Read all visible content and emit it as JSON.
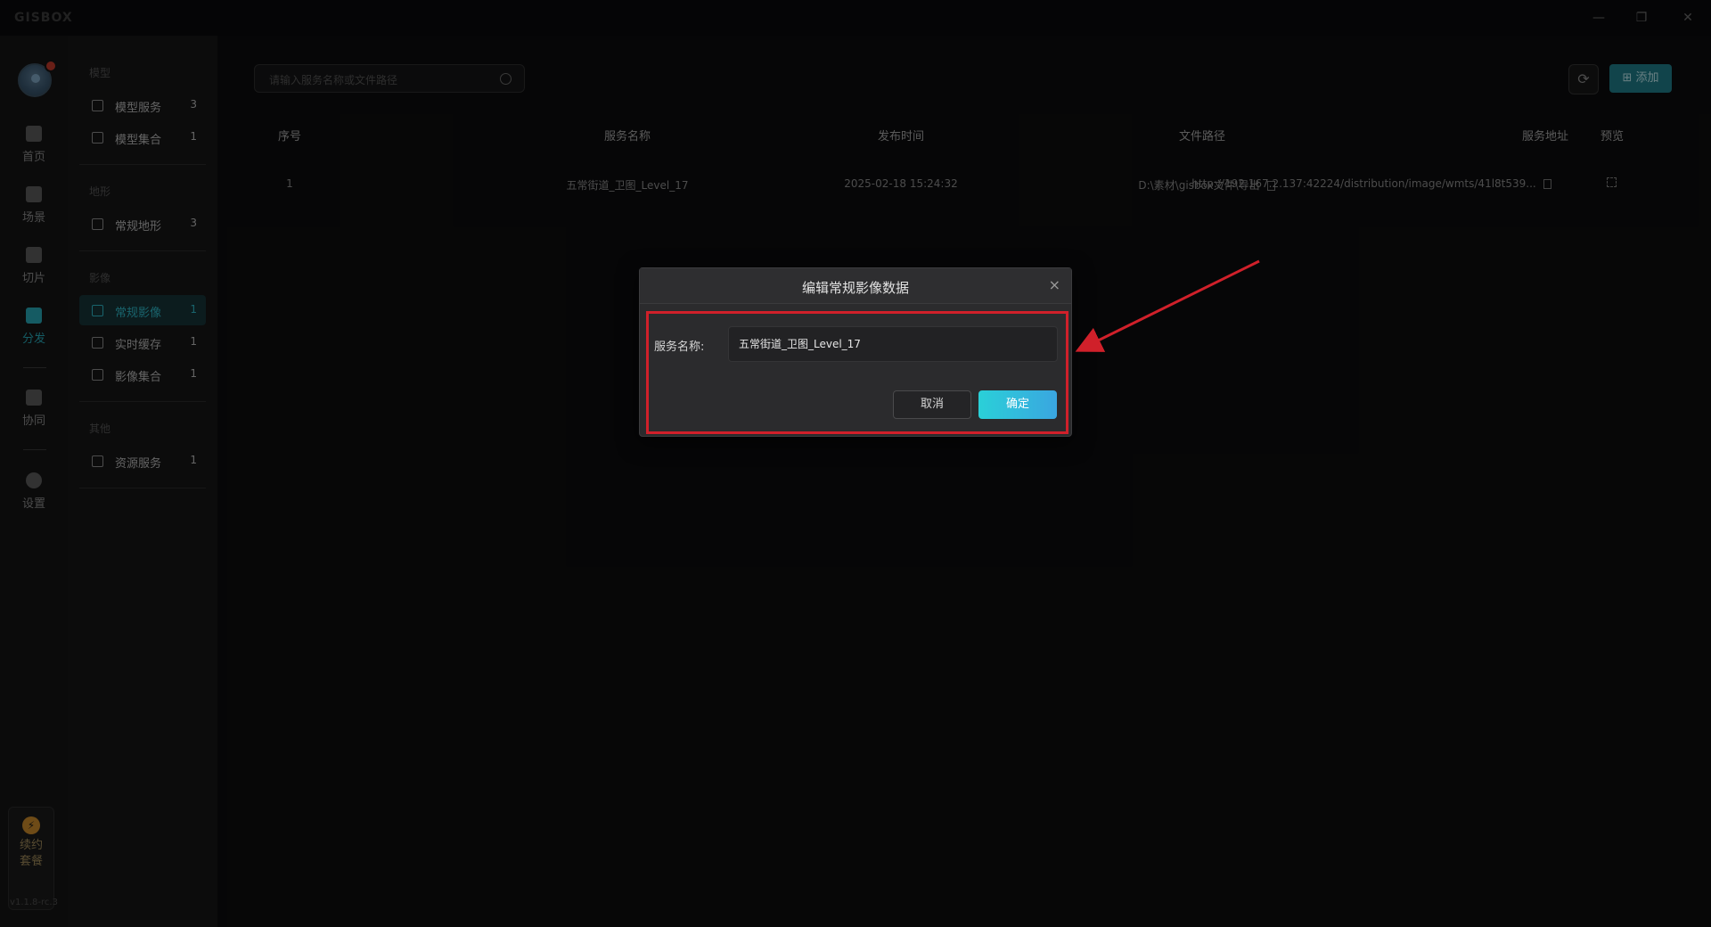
{
  "app": {
    "logo": "GISBOX",
    "version": "v1.1.8-rc.3"
  },
  "window": {
    "minimize": "—",
    "restore": "❐",
    "close": "✕"
  },
  "rail": {
    "items": [
      {
        "label": "首页",
        "icon": "home-icon"
      },
      {
        "label": "场景",
        "icon": "cube-icon"
      },
      {
        "label": "切片",
        "icon": "slice-icon"
      },
      {
        "label": "分发",
        "icon": "distribute-icon",
        "active": true
      },
      {
        "label": "协同",
        "icon": "lock-icon"
      },
      {
        "label": "设置",
        "icon": "gear-icon"
      }
    ],
    "renew": {
      "line1": "续约",
      "line2": "套餐",
      "icon": "⚡"
    }
  },
  "sidebar": {
    "sections": [
      {
        "title": "模型",
        "items": [
          {
            "label": "模型服务",
            "count": "3"
          },
          {
            "label": "模型集合",
            "count": "1"
          }
        ]
      },
      {
        "title": "地形",
        "items": [
          {
            "label": "常规地形",
            "count": "3"
          }
        ]
      },
      {
        "title": "影像",
        "items": [
          {
            "label": "常规影像",
            "count": "1",
            "active": true
          },
          {
            "label": "实时缓存",
            "count": "1"
          },
          {
            "label": "影像集合",
            "count": "1"
          }
        ]
      },
      {
        "title": "其他",
        "items": [
          {
            "label": "资源服务",
            "count": "1"
          }
        ]
      }
    ]
  },
  "toolbar": {
    "search_placeholder": "请输入服务名称或文件路径",
    "refresh_icon": "⟳",
    "add_label": "添加",
    "add_icon": "⊞"
  },
  "table": {
    "columns": [
      "序号",
      "服务名称",
      "发布时间",
      "文件路径",
      "服务地址",
      "预览"
    ],
    "rows": [
      {
        "index": "1",
        "name": "五常街道_卫图_Level_17",
        "time": "2025-02-18 15:24:32",
        "path": "D:\\素材\\gisbox文件\\导出",
        "url": "http://192.167.2.137:42224/distribution/image/wmts/41l8t539..."
      }
    ]
  },
  "dialog": {
    "title": "编辑常规影像数据",
    "close": "×",
    "field_label": "服务名称:",
    "field_value": "五常街道_卫图_Level_17",
    "cancel": "取消",
    "ok": "确定"
  },
  "colors": {
    "accent": "#27a6b5",
    "highlight": "#d0202a"
  }
}
